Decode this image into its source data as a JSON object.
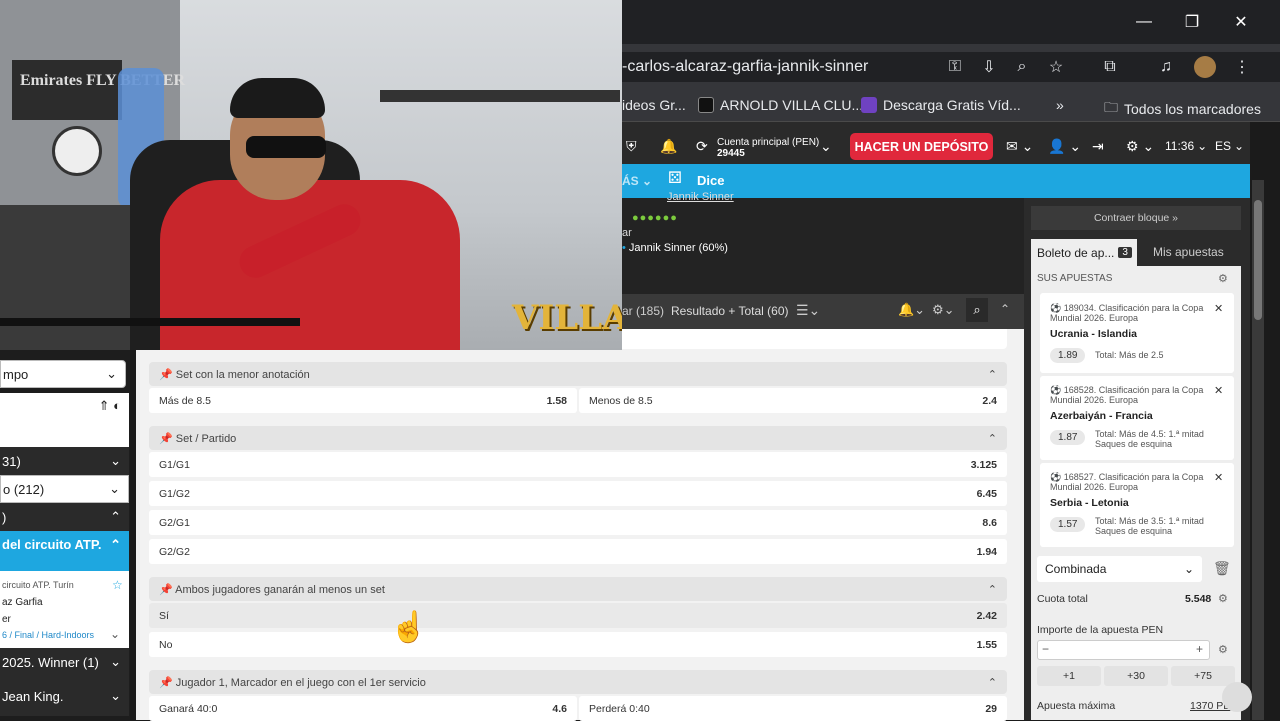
{
  "window": {
    "minimize": "—",
    "restore": "❐",
    "close": "✕"
  },
  "browser": {
    "url": "-carlos-alcaraz-garfia-jannik-sinner",
    "bookmarks": [
      {
        "label": "ideos Gr...",
        "color": "#4285f4"
      },
      {
        "label": "ARNOLD VILLA CLU...",
        "color": "#111111"
      },
      {
        "label": "Descarga Gratis Víd...",
        "color": "#6f42c1"
      }
    ],
    "more_bookmarks": "»",
    "all_bookmarks": "Todos los marcadores"
  },
  "header": {
    "account_label": "Cuenta principal  (PEN)",
    "account_balance": "29445",
    "deposit_label": "HACER UN DEPÓSITO",
    "time": "11:36",
    "lang": "ES"
  },
  "nav": {
    "more": "ÁS",
    "dice": "Dice"
  },
  "scoreboard": {
    "player_top": "Jannik Sinner",
    "bar_label": "ar",
    "player_pct": "Jannik Sinner (60%)"
  },
  "market_tabs": {
    "tab1": "ar (185)",
    "tab2": "Resultado + Total (60)"
  },
  "sidebar": {
    "select": "mpo",
    "rows": [
      {
        "label": "31)"
      },
      {
        "label": "o (212)"
      },
      {
        "label": ")"
      },
      {
        "label": "del circuito ATP."
      },
      {
        "label": "2025. Winner (1)"
      },
      {
        "label": "Jean King."
      }
    ],
    "event_lines": [
      "circuito ATP. Turín",
      "az Garfia",
      "er",
      "6 / Final / Hard-Indoors"
    ]
  },
  "markets": [
    {
      "title": "Set con la menor anotación",
      "rows": [
        [
          "Más de 8.5",
          "1.58",
          "Menos de 8.5",
          "2.4"
        ]
      ]
    },
    {
      "title": "Set / Partido",
      "rows": [
        [
          "G1/G1",
          "3.125"
        ],
        [
          "G1/G2",
          "6.45"
        ],
        [
          "G2/G1",
          "8.6"
        ],
        [
          "G2/G2",
          "1.94"
        ]
      ]
    },
    {
      "title": "Ambos jugadores ganarán al menos un set",
      "rows": [
        [
          "Sí",
          "2.42"
        ],
        [
          "No",
          "1.55"
        ]
      ]
    },
    {
      "title": "Jugador 1, Marcador en el juego con el 1er servicio",
      "rows": [
        [
          "Ganará 40:0",
          "4.6",
          "Perderá 0:40",
          "29"
        ]
      ]
    }
  ],
  "betslip": {
    "contraer": "Contraer bloque »",
    "tab_boleto": "Boleto de ap...",
    "tab_count": "3",
    "tab_mis": "Mis apuestas",
    "sus_apuestas": "SUS APUESTAS",
    "bets": [
      {
        "comp": "189034. Clasificación para la Copa Mundial 2026. Europa",
        "match": "Ucrania - Islandia",
        "odds": "1.89",
        "market": "Total: Más de 2.5"
      },
      {
        "comp": "168528. Clasificación para la Copa Mundial 2026. Europa",
        "match": "Azerbaiyán - Francia",
        "odds": "1.87",
        "market": "Total: Más de 4.5: 1.ª mitad Saques de esquina"
      },
      {
        "comp": "168527. Clasificación para la Copa Mundial 2026. Europa",
        "match": "Serbia - Letonia",
        "odds": "1.57",
        "market": "Total: Más de 3.5: 1.ª mitad Saques de esquina"
      }
    ],
    "type": "Combinada",
    "cuota_label": "Cuota total",
    "cuota_value": "5.548",
    "importe_label": "Importe de la apuesta PEN",
    "quick": [
      "+1",
      "+30",
      "+75"
    ],
    "max_label": "Apuesta máxima",
    "max_value": "1370 PE"
  },
  "overlay": {
    "logo": "VILLA",
    "shirt_text": "Emirates FLY BETTER"
  }
}
